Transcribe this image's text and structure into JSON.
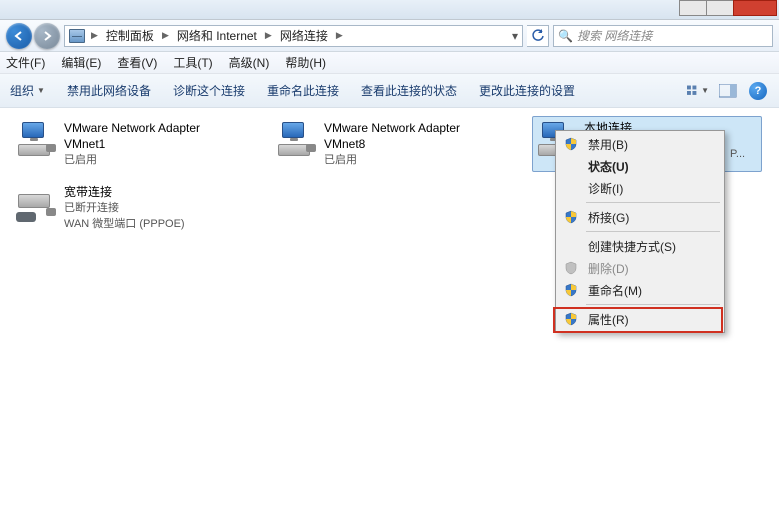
{
  "breadcrumb": {
    "seg1": "控制面板",
    "seg2": "网络和 Internet",
    "seg3": "网络连接"
  },
  "search": {
    "placeholder": "搜索 网络连接"
  },
  "menu": {
    "file": "文件(F)",
    "edit": "编辑(E)",
    "view": "查看(V)",
    "tools": "工具(T)",
    "advanced": "高级(N)",
    "help": "帮助(H)"
  },
  "toolbar": {
    "organize": "组织",
    "disable": "禁用此网络设备",
    "diagnose": "诊断这个连接",
    "rename": "重命名此连接",
    "status": "查看此连接的状态",
    "change": "更改此连接的设置"
  },
  "connections": [
    {
      "name": "VMware Network Adapter VMnet1",
      "status": "已启用",
      "device": "",
      "icon": "lan"
    },
    {
      "name": "VMware Network Adapter VMnet8",
      "status": "已启用",
      "device": "",
      "icon": "lan"
    },
    {
      "name": "本地连接",
      "status": "",
      "device": "",
      "icon": "lan",
      "selected": true,
      "truncated_extra": "P..."
    },
    {
      "name": "宽带连接",
      "status": "已断开连接",
      "device": "WAN 微型端口 (PPPOE)",
      "icon": "modem"
    }
  ],
  "context_menu": {
    "disable": "禁用(B)",
    "status": "状态(U)",
    "diagnose": "诊断(I)",
    "bridge": "桥接(G)",
    "shortcut": "创建快捷方式(S)",
    "delete": "删除(D)",
    "rename": "重命名(M)",
    "properties": "属性(R)"
  }
}
